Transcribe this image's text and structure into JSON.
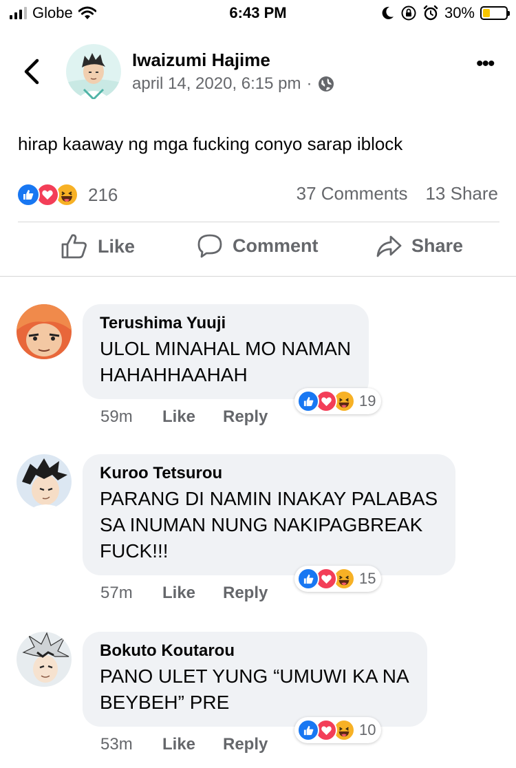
{
  "status_bar": {
    "carrier": "Globe",
    "time": "6:43 PM",
    "battery": "30%",
    "battery_level": 0.3,
    "icons": [
      "signal-icon",
      "wifi-icon",
      "moon-icon",
      "orientation-lock-icon",
      "alarm-icon",
      "battery-charging-icon"
    ]
  },
  "post": {
    "author": "Iwaizumi Hajime",
    "date": "april 14, 2020, 6:15 pm",
    "separator": "·",
    "privacy_icon": "globe-icon",
    "text": "hirap kaaway ng mga fucking conyo sarap iblock",
    "reaction_count": "216",
    "comments_count": "37 Comments",
    "shares_count": "13 Share",
    "actions": {
      "like": "Like",
      "comment": "Comment",
      "share": "Share"
    }
  },
  "comments": [
    {
      "name": "Terushima Yuuji",
      "text": "ULOL MINAHAL MO NAMAN\nHAHAHHAAHAH",
      "time": "59m",
      "like": "Like",
      "reply": "Reply",
      "reactions": "19"
    },
    {
      "name": "Kuroo Tetsurou",
      "text": "PARANG DI NAMIN INAKAY PALABAS\nSA  INUMAN NUNG NAKIPAGBREAK\nFUCK!!!",
      "time": "57m",
      "like": "Like",
      "reply": "Reply",
      "reactions": "15"
    },
    {
      "name": "Bokuto Koutarou",
      "text": "PANO ULET YUNG “UMUWI KA NA\nBEYBEH” PRE",
      "time": "53m",
      "like": "Like",
      "reply": "Reply",
      "reactions": "10"
    }
  ],
  "colors": {
    "like_blue": "#1877f2",
    "love_red": "#f33e58",
    "haha_yellow": "#f7b125",
    "secondary_text": "#65676b",
    "bubble_bg": "#f0f2f5"
  }
}
